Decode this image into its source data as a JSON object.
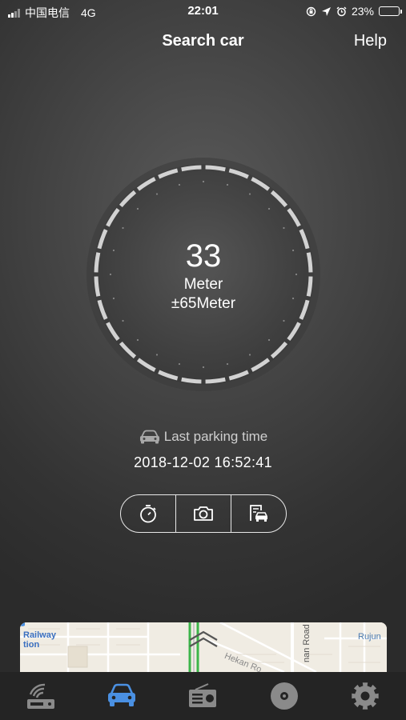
{
  "status_bar": {
    "carrier": "中国电信",
    "network": "4G",
    "time": "22:01",
    "battery_percent": "23%",
    "battery_level": 0.23
  },
  "nav": {
    "title": "Search car",
    "help": "Help"
  },
  "dial": {
    "distance_value": "33",
    "distance_unit": "Meter",
    "accuracy": "±65Meter"
  },
  "parking": {
    "label": "Last parking time",
    "timestamp": "2018-12-02 16:52:41"
  },
  "actions": [
    {
      "name": "timer",
      "icon": "timer-icon"
    },
    {
      "name": "camera",
      "icon": "camera-icon"
    },
    {
      "name": "parking-note",
      "icon": "parking-note-icon"
    }
  ],
  "map": {
    "labels": {
      "railway": "Railway",
      "station": "tion",
      "hekan_road": "Hekan Ro",
      "nan_road": "nan Road",
      "rujun": "Rujun"
    }
  },
  "tabs": [
    {
      "name": "router",
      "icon": "router-icon",
      "active": false
    },
    {
      "name": "car",
      "icon": "car-icon",
      "active": true
    },
    {
      "name": "radio",
      "icon": "radio-icon",
      "active": false
    },
    {
      "name": "disc",
      "icon": "disc-icon",
      "active": false
    },
    {
      "name": "settings",
      "icon": "gear-icon",
      "active": false
    }
  ],
  "colors": {
    "accent": "#4a90e2",
    "tab_inactive": "#8a8a8a",
    "map_bg": "#f0ece3",
    "map_road_green": "#3cb54a"
  }
}
